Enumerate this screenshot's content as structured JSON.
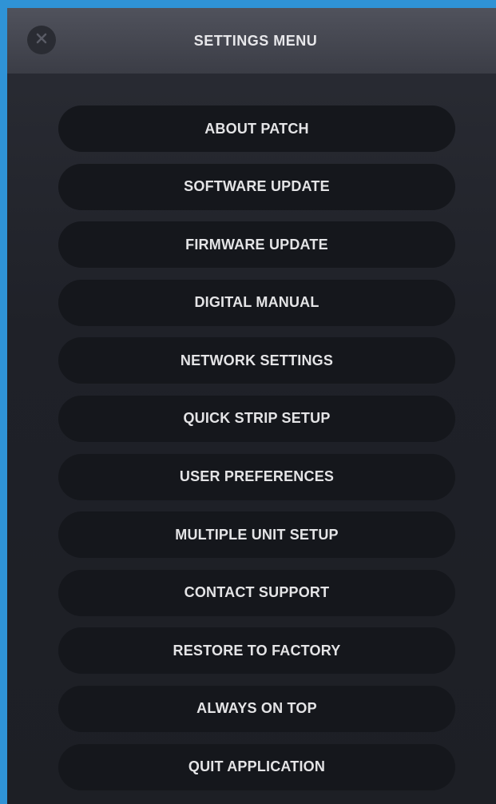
{
  "header": {
    "title": "SETTINGS MENU",
    "close_icon": "close-icon"
  },
  "colors": {
    "accent_border": "#2f93d6",
    "header_bg": "#464851",
    "body_bg": "#1f2128",
    "button_bg": "#15171c",
    "text": "#e4e4e6"
  },
  "menu": {
    "items": [
      {
        "label": "ABOUT PATCH"
      },
      {
        "label": "SOFTWARE UPDATE"
      },
      {
        "label": "FIRMWARE UPDATE"
      },
      {
        "label": "DIGITAL MANUAL"
      },
      {
        "label": "NETWORK SETTINGS"
      },
      {
        "label": "QUICK STRIP SETUP"
      },
      {
        "label": "USER PREFERENCES"
      },
      {
        "label": "MULTIPLE UNIT SETUP"
      },
      {
        "label": "CONTACT SUPPORT"
      },
      {
        "label": "RESTORE TO FACTORY"
      },
      {
        "label": "ALWAYS ON TOP"
      },
      {
        "label": "QUIT APPLICATION"
      }
    ]
  }
}
